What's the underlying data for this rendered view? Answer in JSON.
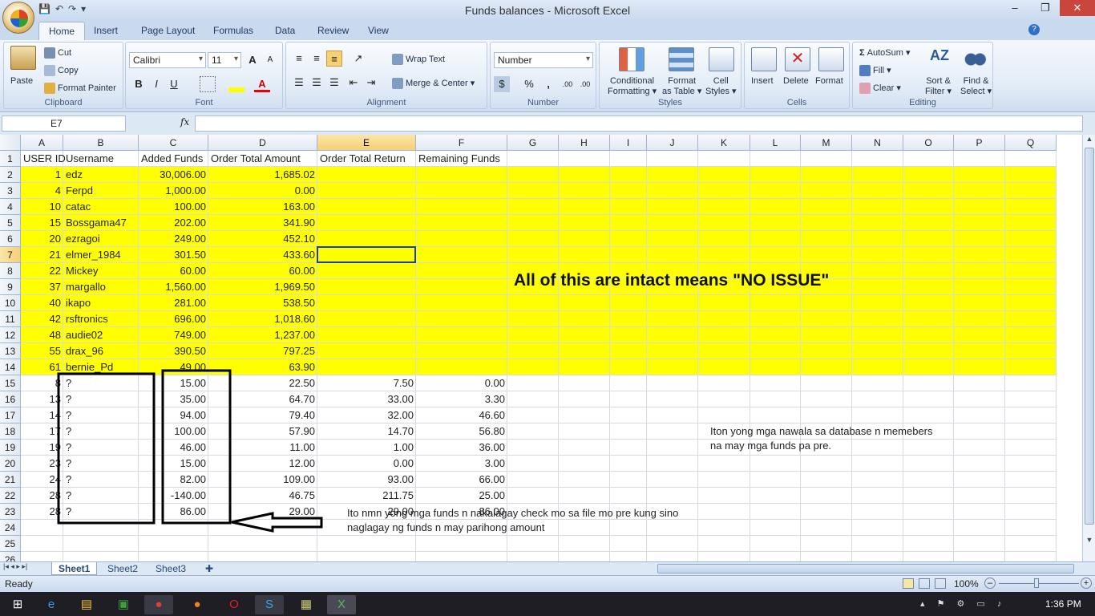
{
  "window": {
    "title": "Funds balances - Microsoft Excel",
    "minimize": "–",
    "restore": "❐",
    "close": "✕"
  },
  "qat": {
    "save": "💾",
    "undo": "↶",
    "redo": "↷",
    "more": "▾"
  },
  "tabs": [
    "Home",
    "Insert",
    "Page Layout",
    "Formulas",
    "Data",
    "Review",
    "View"
  ],
  "ribbon": {
    "clipboard": {
      "label": "Clipboard",
      "paste": "Paste",
      "cut": "Cut",
      "copy": "Copy",
      "format_painter": "Format Painter"
    },
    "font": {
      "label": "Font",
      "name": "Calibri",
      "size": "11",
      "bold": "B",
      "italic": "I",
      "underline": "U",
      "grow": "A",
      "shrink": "A",
      "font_color": "A"
    },
    "alignment": {
      "label": "Alignment",
      "wrap_text": "Wrap Text",
      "merge_center": "Merge & Center"
    },
    "number": {
      "label": "Number",
      "format": "Number",
      "currency": "$",
      "percent": "%",
      "comma": ",",
      "inc_dec": ".00",
      "dec_dec": ".00"
    },
    "styles": {
      "label": "Styles",
      "conditional": [
        "Conditional",
        "Formatting"
      ],
      "format_table": [
        "Format",
        "as Table"
      ],
      "cell_styles": [
        "Cell",
        "Styles"
      ]
    },
    "cells": {
      "label": "Cells",
      "insert": "Insert",
      "delete": "Delete",
      "format": "Format"
    },
    "editing": {
      "label": "Editing",
      "autosum": "AutoSum",
      "fill": "Fill",
      "clear": "Clear",
      "sort_filter": [
        "Sort &",
        "Filter"
      ],
      "find_select": [
        "Find &",
        "Select"
      ]
    }
  },
  "formula_bar": {
    "name_box": "E7",
    "fx": "fx",
    "value": ""
  },
  "columns": [
    "A",
    "B",
    "C",
    "D",
    "E",
    "F",
    "G",
    "H",
    "I",
    "J",
    "K",
    "L",
    "M",
    "N",
    "O",
    "P",
    "Q"
  ],
  "selected_cell": "E7",
  "rows": [
    {
      "n": "1",
      "cells": {
        "A": "USER ID",
        "B": "Username",
        "C": "Added Funds",
        "D": "Order Total Amount",
        "E": "Order Total Return",
        "F": "Remaining Funds"
      }
    },
    {
      "n": "2",
      "cells": {
        "A": "1",
        "B": "edz",
        "C": "30,006.00",
        "D": "1,685.02"
      }
    },
    {
      "n": "3",
      "cells": {
        "A": "4",
        "B": "Ferpd",
        "C": "1,000.00",
        "D": "0.00"
      }
    },
    {
      "n": "4",
      "cells": {
        "A": "10",
        "B": "catac",
        "C": "100.00",
        "D": "163.00"
      }
    },
    {
      "n": "5",
      "cells": {
        "A": "15",
        "B": "Bossgama47",
        "C": "202.00",
        "D": "341.90"
      }
    },
    {
      "n": "6",
      "cells": {
        "A": "20",
        "B": "ezragoi",
        "C": "249.00",
        "D": "452.10"
      }
    },
    {
      "n": "7",
      "cells": {
        "A": "21",
        "B": "elmer_1984",
        "C": "301.50",
        "D": "433.60"
      }
    },
    {
      "n": "8",
      "cells": {
        "A": "22",
        "B": "Mickey",
        "C": "60.00",
        "D": "60.00"
      }
    },
    {
      "n": "9",
      "cells": {
        "A": "37",
        "B": "margallo",
        "C": "1,560.00",
        "D": "1,969.50"
      }
    },
    {
      "n": "10",
      "cells": {
        "A": "40",
        "B": "ikapo",
        "C": "281.00",
        "D": "538.50"
      }
    },
    {
      "n": "11",
      "cells": {
        "A": "42",
        "B": "rsftronics",
        "C": "696.00",
        "D": "1,018.60"
      }
    },
    {
      "n": "12",
      "cells": {
        "A": "48",
        "B": "audie02",
        "C": "749.00",
        "D": "1,237.00"
      }
    },
    {
      "n": "13",
      "cells": {
        "A": "55",
        "B": "drax_96",
        "C": "390.50",
        "D": "797.25"
      }
    },
    {
      "n": "14",
      "cells": {
        "A": "61",
        "B": "bernie_Pd",
        "C": "49.00",
        "D": "63.90"
      }
    },
    {
      "n": "15",
      "cells": {
        "A": "8",
        "B": "?",
        "C": "15.00",
        "D": "22.50",
        "E": "7.50",
        "F": "0.00"
      }
    },
    {
      "n": "16",
      "cells": {
        "A": "13",
        "B": "?",
        "C": "35.00",
        "D": "64.70",
        "E": "33.00",
        "F": "3.30"
      }
    },
    {
      "n": "17",
      "cells": {
        "A": "14",
        "B": "?",
        "C": "94.00",
        "D": "79.40",
        "E": "32.00",
        "F": "46.60"
      }
    },
    {
      "n": "18",
      "cells": {
        "A": "17",
        "B": "?",
        "C": "100.00",
        "D": "57.90",
        "E": "14.70",
        "F": "56.80"
      }
    },
    {
      "n": "19",
      "cells": {
        "A": "19",
        "B": "?",
        "C": "46.00",
        "D": "11.00",
        "E": "1.00",
        "F": "36.00"
      }
    },
    {
      "n": "20",
      "cells": {
        "A": "23",
        "B": "?",
        "C": "15.00",
        "D": "12.00",
        "E": "0.00",
        "F": "3.00"
      }
    },
    {
      "n": "21",
      "cells": {
        "A": "24",
        "B": "?",
        "C": "82.00",
        "D": "109.00",
        "E": "93.00",
        "F": "66.00"
      }
    },
    {
      "n": "22",
      "cells": {
        "A": "28",
        "B": "?",
        "C": "-140.00",
        "D": "46.75",
        "E": "211.75",
        "F": "25.00"
      }
    },
    {
      "n": "23",
      "cells": {
        "A": "28",
        "B": "?",
        "C": "86.00",
        "D": "29.00",
        "E": "29.00",
        "F": "86.00"
      }
    },
    {
      "n": "24",
      "cells": {}
    },
    {
      "n": "25",
      "cells": {}
    },
    {
      "n": "26",
      "cells": {}
    }
  ],
  "annotations": {
    "no_issue": "All of this are intact means \"NO ISSUE\"",
    "note_k19": "Iton yong mga nawala sa database n memebers",
    "note_k20": "na may mga funds pa pre.",
    "note_e24": "Ito nmn yong mga funds n nakalagay check mo sa file mo pre kung sino",
    "note_e25": "naglagay ng funds n may parihong amount"
  },
  "highlight_color": "#ffff00",
  "sheets": [
    "Sheet1",
    "Sheet2",
    "Sheet3"
  ],
  "active_sheet": "Sheet1",
  "status": {
    "ready": "Ready",
    "zoom": "100%"
  },
  "taskbar": {
    "clock": "1:36 PM"
  }
}
